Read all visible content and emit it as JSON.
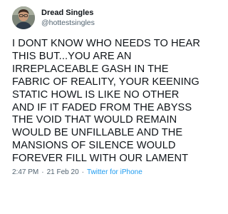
{
  "author": {
    "display_name": "Dread Singles",
    "handle": "@hottestsingles",
    "avatar_icon": "user-avatar-photo"
  },
  "tweet": {
    "text": "I DONT KNOW WHO NEEDS TO HEAR THIS BUT...YOU ARE AN IRREPLACEABLE GASH IN THE FABRIC OF REALITY, YOUR KEENING STATIC HOWL IS LIKE NO OTHER AND IF IT FADED FROM THE ABYSS THE VOID THAT WOULD REMAIN WOULD BE UNFILLABLE AND THE MANSIONS OF SILENCE WOULD FOREVER FILL WITH OUR LAMENT",
    "time": "2:47 PM",
    "date": "21 Feb 20",
    "separator": "·",
    "source": "Twitter for iPhone"
  },
  "colors": {
    "text": "#0f1419",
    "secondary": "#536471",
    "link": "#1d9bf0",
    "background": "#ffffff"
  }
}
